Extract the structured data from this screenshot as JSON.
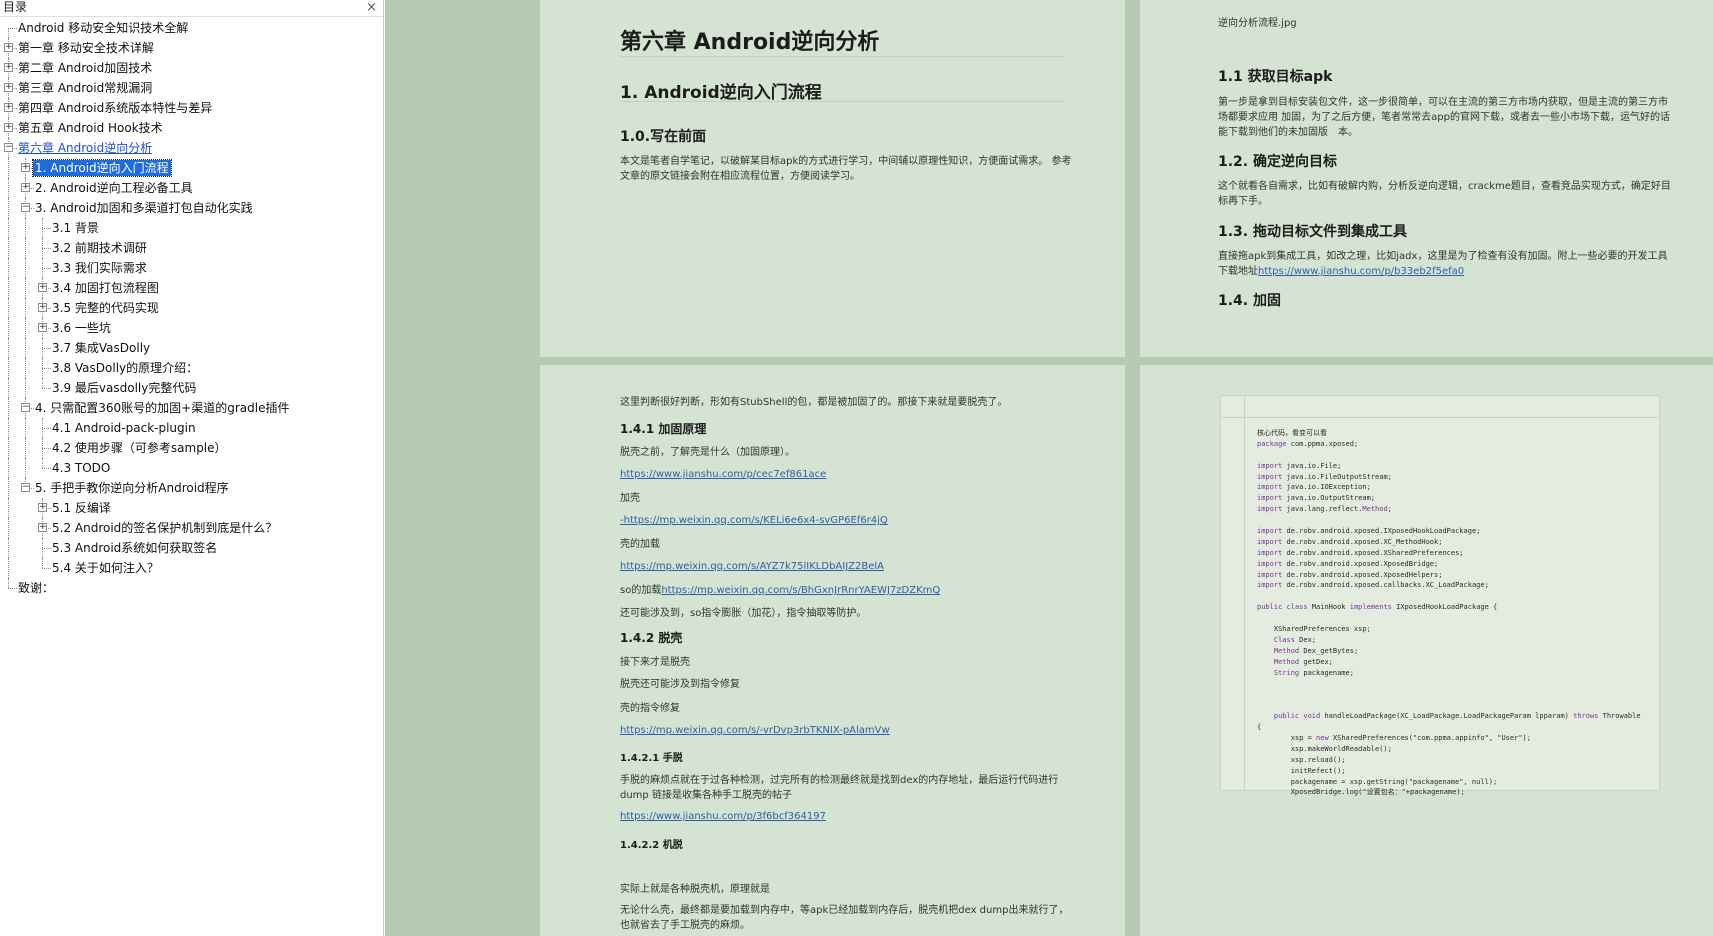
{
  "sidebar": {
    "title": "目录",
    "close_glyph": "×",
    "toc": [
      {
        "label": "Android 移动安全知识技术全解",
        "level": 0,
        "expander": "none"
      },
      {
        "label": "第一章 移动安全技术详解",
        "level": 0,
        "expander": "plus"
      },
      {
        "label": "第二章 Android加固技术",
        "level": 0,
        "expander": "plus"
      },
      {
        "label": "第三章 Android常规漏洞",
        "level": 0,
        "expander": "plus"
      },
      {
        "label": "第四章 Android系统版本特性与差异",
        "level": 0,
        "expander": "plus"
      },
      {
        "label": "第五章 Android Hook技术",
        "level": 0,
        "expander": "plus"
      },
      {
        "label": "第六章 Android逆向分析",
        "level": 0,
        "expander": "minus",
        "state": "link"
      },
      {
        "label": "1. Android逆向入门流程",
        "level": 1,
        "expander": "plus",
        "state": "selected"
      },
      {
        "label": "2. Android逆向工程必备工具",
        "level": 1,
        "expander": "plus"
      },
      {
        "label": "3. Android加固和多渠道打包自动化实践",
        "level": 1,
        "expander": "minus"
      },
      {
        "label": "3.1 背景",
        "level": 2,
        "expander": "none"
      },
      {
        "label": "3.2 前期技术调研",
        "level": 2,
        "expander": "none"
      },
      {
        "label": "3.3 我们实际需求",
        "level": 2,
        "expander": "none"
      },
      {
        "label": "3.4 加固打包流程图",
        "level": 2,
        "expander": "plus"
      },
      {
        "label": "3.5 完整的代码实现",
        "level": 2,
        "expander": "plus"
      },
      {
        "label": "3.6 一些坑",
        "level": 2,
        "expander": "plus"
      },
      {
        "label": "3.7 集成VasDolly",
        "level": 2,
        "expander": "none"
      },
      {
        "label": "3.8 VasDolly的原理介绍：",
        "level": 2,
        "expander": "none"
      },
      {
        "label": "3.9 最后vasdolly完整代码",
        "level": 2,
        "expander": "none"
      },
      {
        "label": "4. 只需配置360账号的加固+渠道的gradle插件",
        "level": 1,
        "expander": "minus"
      },
      {
        "label": "4.1 Android-pack-plugin",
        "level": 2,
        "expander": "none"
      },
      {
        "label": "4.2 使用步骤（可参考sample）",
        "level": 2,
        "expander": "none"
      },
      {
        "label": "4.3 TODO",
        "level": 2,
        "expander": "none"
      },
      {
        "label": "5. 手把手教你逆向分析Android程序",
        "level": 1,
        "expander": "minus"
      },
      {
        "label": "5.1 反编译",
        "level": 2,
        "expander": "plus"
      },
      {
        "label": "5.2 Android的签名保护机制到底是什么？",
        "level": 2,
        "expander": "plus"
      },
      {
        "label": "5.3 Android系统如何获取签名",
        "level": 2,
        "expander": "none"
      },
      {
        "label": "5.4 关于如何注入？",
        "level": 2,
        "expander": "none"
      },
      {
        "label": "致谢：",
        "level": 0,
        "expander": "none"
      }
    ]
  },
  "page1": {
    "chapter_title": "第六章 Android逆向分析",
    "section_title": "1. Android逆向入门流程",
    "sub_title": "1.0.写在前面",
    "intro_line1": "本文是笔者自学笔记，以破解某目标apk的方式进行学习，中间辅以原理性知识，方便面试需求。 参考",
    "intro_line2": "文章的原文链接会附在相应流程位置，方便阅读学习。"
  },
  "page2": {
    "image_caption": "逆向分析流程.jpg",
    "h_1_1": "1.1 获取目标apk",
    "p_1_1_a": "第一步是拿到目标安装包文件，这一步很简单，可以在主流的第三方市场内获取，但是主流的第三方市",
    "p_1_1_b": "场都要求应用 加固，为了之后方便，笔者常常去app的官网下载，或者去一些小市场下载，运气好的话",
    "p_1_1_c": "能下载到他们的未加固版　本。",
    "h_1_2": "1.2. 确定逆向目标",
    "p_1_2_a": "这个就看各自需求，比如有破解内购，分析反逆向逻辑，crackme题目，查看竞品实现方式，确定好目",
    "p_1_2_b": "标再下手。",
    "h_1_3": "1.3. 拖动目标文件到集成工具",
    "p_1_3_a": "直接拖apk到集成工具，如改之理，比如jadx，这里是为了检查有没有加固。附上一些必要的开发工具",
    "p_1_3_b_prefix": "下载地址",
    "p_1_3_link": "https://www.jianshu.com/p/b33eb2f5efa0",
    "h_1_4": "1.4. 加固"
  },
  "page3": {
    "line_intro": "这里判断很好判断，形如有StubShell的包，都是被加固了的。那接下来就是要脱壳了。",
    "h_1_4_1": "1.4.1 加固原理",
    "p_before": "脱壳之前，了解壳是什么（加固原理）。",
    "link1": "https://www.jianshu.com/p/cec7ef861ace",
    "p_jiake": "加壳",
    "link2": "-https://mp.weixin.qq.com/s/KELi6e6x4-svGP6Ef6r4jQ",
    "p_ke_load": "壳的加载",
    "link3": "https://mp.weixin.qq.com/s/AYZ7k75lIKLDbAIJZ2BelA",
    "p_so_prefix": "so的加载",
    "link4": "https://mp.weixin.qq.com/s/BhGxnJrRnrYAEWJ7zDZKmQ",
    "p_also": "还可能涉及到，so指令膨胀（加花），指令抽取等防护。",
    "h_1_4_2": "1.4.2 脱壳",
    "p_next": "接下来才是脱壳",
    "p_repair": "脱壳还可能涉及到指令修复",
    "p_ke_repair": "壳的指令修复",
    "link5": "https://mp.weixin.qq.com/s/-vrDvp3rbTKNIX-pAlamVw",
    "h_1_4_2_1": "1.4.2.1 手脱",
    "p_manual_a": "手脱的麻烦点就在于过各种检测，过完所有的检测最终就是找到dex的内存地址，最后运行代码进行",
    "p_manual_b": "dump  链接是收集各种手工脱壳的帖子",
    "link6": "https://www.jianshu.com/p/3f6bcf364197",
    "h_1_4_2_2": "1.4.2.2 机脱",
    "p_machine": "实际上就是各种脱壳机，原理就是",
    "p_anyway_a": "无论什么壳，最终都是要加载到内存中，等apk已经加载到内存后，脱壳机把dex  dump出来就行了，",
    "p_anyway_b": "也就省去了手工脱壳的麻烦。"
  },
  "page4": {
    "code_lines": [
      "核心代码，看变可以看",
      "package com.ppma.xposed;",
      "",
      "import java.io.File;",
      "import java.io.FileOutputStream;",
      "import java.io.IOException;",
      "import java.io.OutputStream;",
      "import java.lang.reflect.Method;",
      "",
      "import de.robv.android.xposed.IXposedHookLoadPackage;",
      "import de.robv.android.xposed.XC_MethodHook;",
      "import de.robv.android.xposed.XSharedPreferences;",
      "import de.robv.android.xposed.XposedBridge;",
      "import de.robv.android.xposed.XposedHelpers;",
      "import de.robv.android.xposed.callbacks.XC_LoadPackage;",
      "",
      "public class MainHook implements IXposedHookLoadPackage {",
      "",
      "    XSharedPreferences xsp;",
      "    Class Dex;",
      "    Method Dex_getBytes;",
      "    Method getDex;",
      "    String packagename;",
      "",
      "",
      "",
      "    public void handleLoadPackage(XC_LoadPackage.LoadPackageParam lpparam) throws Throwable",
      "{",
      "        xsp = new XSharedPreferences(\"com.ppma.appinfo\", \"User\");",
      "        xsp.makeWorldReadable();",
      "        xsp.reload();",
      "        initRefect();",
      "        packagename = xsp.getString(\"packagename\", null);",
      "        XposedBridge.log(\"设置包名：\"+packagename);"
    ]
  }
}
